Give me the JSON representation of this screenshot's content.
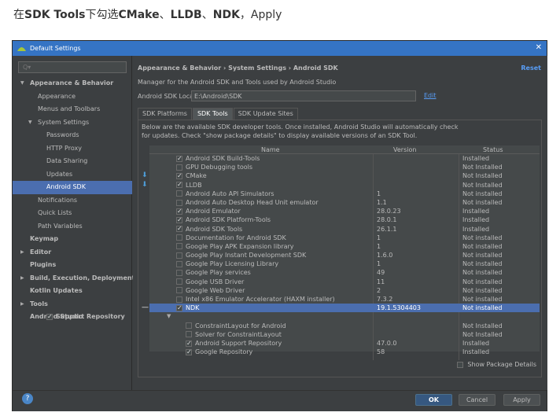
{
  "caption": {
    "prefix": "在",
    "bold1": "SDK Tools",
    "mid1": "下勾选",
    "bold2": "CMake",
    "sep1": "、",
    "bold3": "LLDB",
    "sep2": "、",
    "bold4": "NDK",
    "suffix": "，Apply"
  },
  "window": {
    "title": "Default Settings",
    "close": "✕"
  },
  "sidebar": {
    "search_placeholder": "Q▾",
    "items": [
      {
        "label": "Appearance & Behavior",
        "bold": true,
        "indent": 0,
        "arrow": "▼"
      },
      {
        "label": "Appearance",
        "indent": 1
      },
      {
        "label": "Menus and Toolbars",
        "indent": 1
      },
      {
        "label": "System Settings",
        "indent": 1,
        "arrow": "▼"
      },
      {
        "label": "Passwords",
        "indent": 2
      },
      {
        "label": "HTTP Proxy",
        "indent": 2
      },
      {
        "label": "Data Sharing",
        "indent": 2
      },
      {
        "label": "Updates",
        "indent": 2
      },
      {
        "label": "Android SDK",
        "indent": 2,
        "selected": true
      },
      {
        "label": "Notifications",
        "indent": 1
      },
      {
        "label": "Quick Lists",
        "indent": 1
      },
      {
        "label": "Path Variables",
        "indent": 1
      },
      {
        "label": "Keymap",
        "bold": true,
        "indent": 0
      },
      {
        "label": "Editor",
        "bold": true,
        "indent": 0,
        "arrow": "▶"
      },
      {
        "label": "Plugins",
        "bold": true,
        "indent": 0
      },
      {
        "label": "Build, Execution, Deployment",
        "bold": true,
        "indent": 0,
        "arrow": "▶"
      },
      {
        "label": "Kotlin Updates",
        "bold": true,
        "indent": 0
      },
      {
        "label": "Tools",
        "bold": true,
        "indent": 0,
        "arrow": "▶"
      },
      {
        "label": "Android Studio",
        "bold": true,
        "indent": 0
      }
    ]
  },
  "content": {
    "breadcrumb": "Appearance & Behavior  ›  System Settings  ›  Android SDK",
    "reset": "Reset",
    "description": "Manager for the Android SDK and Tools used by Android Studio",
    "location_label": "Android SDK Location:",
    "location_value": "E:\\Android\\SDK",
    "edit": "Edit",
    "tabs": [
      "SDK Platforms",
      "SDK Tools",
      "SDK Update Sites"
    ],
    "active_tab": 1,
    "info_line1": "Below are the available SDK developer tools. Once installed, Android Studio will automatically check",
    "info_line2": "for updates. Check \"show package details\" to display available versions of an SDK Tool.",
    "columns": {
      "name": "Name",
      "version": "Version",
      "status": "Status"
    },
    "rows": [
      {
        "name": "Android SDK Build-Tools",
        "version": "",
        "status": "Installed",
        "checked": true,
        "level": 0
      },
      {
        "name": "GPU Debugging tools",
        "version": "",
        "status": "Not Installed",
        "checked": false,
        "level": 0
      },
      {
        "name": "CMake",
        "version": "",
        "status": "Not Installed",
        "checked": true,
        "level": 0,
        "marker": true
      },
      {
        "name": "LLDB",
        "version": "",
        "status": "Not Installed",
        "checked": true,
        "level": 0,
        "marker": true
      },
      {
        "name": "Android Auto API Simulators",
        "version": "1",
        "status": "Not installed",
        "checked": false,
        "level": 0
      },
      {
        "name": "Android Auto Desktop Head Unit emulator",
        "version": "1.1",
        "status": "Not installed",
        "checked": false,
        "level": 0
      },
      {
        "name": "Android Emulator",
        "version": "28.0.23",
        "status": "Installed",
        "checked": true,
        "level": 0
      },
      {
        "name": "Android SDK Platform-Tools",
        "version": "28.0.1",
        "status": "Installed",
        "checked": true,
        "level": 0
      },
      {
        "name": "Android SDK Tools",
        "version": "26.1.1",
        "status": "Installed",
        "checked": true,
        "level": 0
      },
      {
        "name": "Documentation for Android SDK",
        "version": "1",
        "status": "Not installed",
        "checked": false,
        "level": 0
      },
      {
        "name": "Google Play APK Expansion library",
        "version": "1",
        "status": "Not installed",
        "checked": false,
        "level": 0
      },
      {
        "name": "Google Play Instant Development SDK",
        "version": "1.6.0",
        "status": "Not installed",
        "checked": false,
        "level": 0
      },
      {
        "name": "Google Play Licensing Library",
        "version": "1",
        "status": "Not installed",
        "checked": false,
        "level": 0
      },
      {
        "name": "Google Play services",
        "version": "49",
        "status": "Not installed",
        "checked": false,
        "level": 0
      },
      {
        "name": "Google USB Driver",
        "version": "11",
        "status": "Not installed",
        "checked": false,
        "level": 0
      },
      {
        "name": "Google Web Driver",
        "version": "2",
        "status": "Not installed",
        "checked": false,
        "level": 0
      },
      {
        "name": "Intel x86 Emulator Accelerator (HAXM installer)",
        "version": "7.3.2",
        "status": "Not installed",
        "checked": false,
        "level": 0
      },
      {
        "name": "NDK",
        "version": "19.1.5304403",
        "status": "Not installed",
        "checked": true,
        "level": 0,
        "selected": true,
        "marker_minus": true
      },
      {
        "name": "Support Repository",
        "version": "",
        "status": "",
        "checked": true,
        "level": -1,
        "group": true
      },
      {
        "name": "ConstraintLayout for Android",
        "version": "",
        "status": "Not Installed",
        "checked": false,
        "level": 1
      },
      {
        "name": "Solver for ConstraintLayout",
        "version": "",
        "status": "Not Installed",
        "checked": false,
        "level": 1
      },
      {
        "name": "Android Support Repository",
        "version": "47.0.0",
        "status": "Installed",
        "checked": true,
        "level": 1
      },
      {
        "name": "Google Repository",
        "version": "58",
        "status": "Installed",
        "checked": true,
        "level": 1
      }
    ],
    "show_details": "Show Package Details"
  },
  "footer": {
    "help": "?",
    "ok": "OK",
    "cancel": "Cancel",
    "apply": "Apply"
  }
}
